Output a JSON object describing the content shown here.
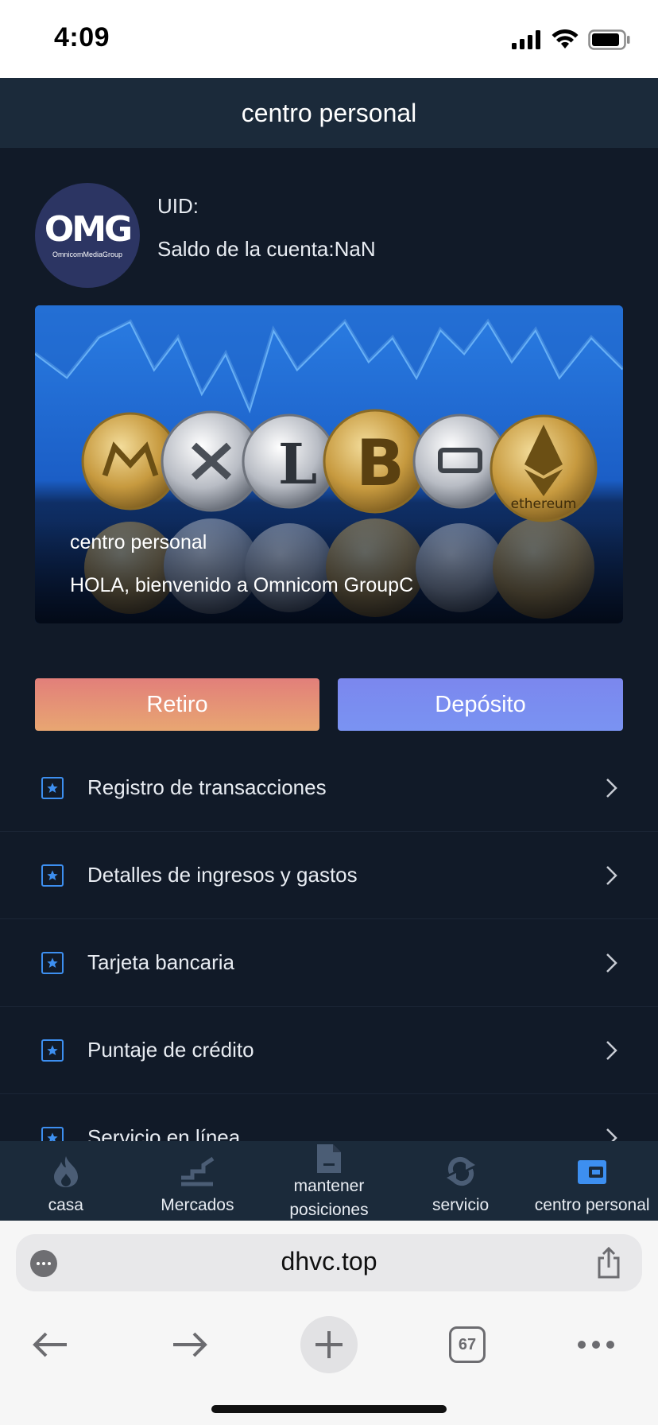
{
  "status_bar": {
    "time": "4:09"
  },
  "header": {
    "title": "centro personal"
  },
  "profile": {
    "avatar_logo": "OMG",
    "avatar_subtitle": "OmnicomMediaGroup",
    "uid_label": "UID:",
    "balance_label": "Saldo de la cuenta:NaN"
  },
  "banner": {
    "coins": [
      "monero",
      "ripple",
      "litecoin",
      "bitcoin",
      "dash",
      "ethereum"
    ],
    "coin_text": "ethereum",
    "caption_title": "centro personal",
    "caption_text": "HOLA, bienvenido a Omnicom GroupC"
  },
  "actions": {
    "withdraw": "Retiro",
    "deposit": "Depósito"
  },
  "menu": {
    "items": [
      {
        "label": "Registro de transacciones",
        "icon": "star-square-icon"
      },
      {
        "label": "Detalles de ingresos y gastos",
        "icon": "star-square-icon"
      },
      {
        "label": "Tarjeta bancaria",
        "icon": "star-square-icon"
      },
      {
        "label": "Puntaje de crédito",
        "icon": "star-square-icon"
      },
      {
        "label": "Servicio en línea",
        "icon": "star-square-icon"
      }
    ]
  },
  "tabbar": {
    "items": [
      {
        "label": "casa",
        "icon": "flame-icon",
        "active": false
      },
      {
        "label": "Mercados",
        "icon": "stairs-icon",
        "active": false
      },
      {
        "label": "mantener posiciones",
        "icon": "document-icon",
        "active": false
      },
      {
        "label": "servicio",
        "icon": "refresh-icon",
        "active": false
      },
      {
        "label": "centro personal",
        "icon": "wallet-icon",
        "active": true
      }
    ]
  },
  "browser": {
    "url": "dhvc.top",
    "tab_count": "67"
  },
  "colors": {
    "app_background": "#111a28",
    "header_background": "#1b2a3a",
    "accent_blue": "#3d8ff0",
    "withdraw_gradient": "#e27f7a",
    "deposit_gradient": "#7b87ee"
  }
}
